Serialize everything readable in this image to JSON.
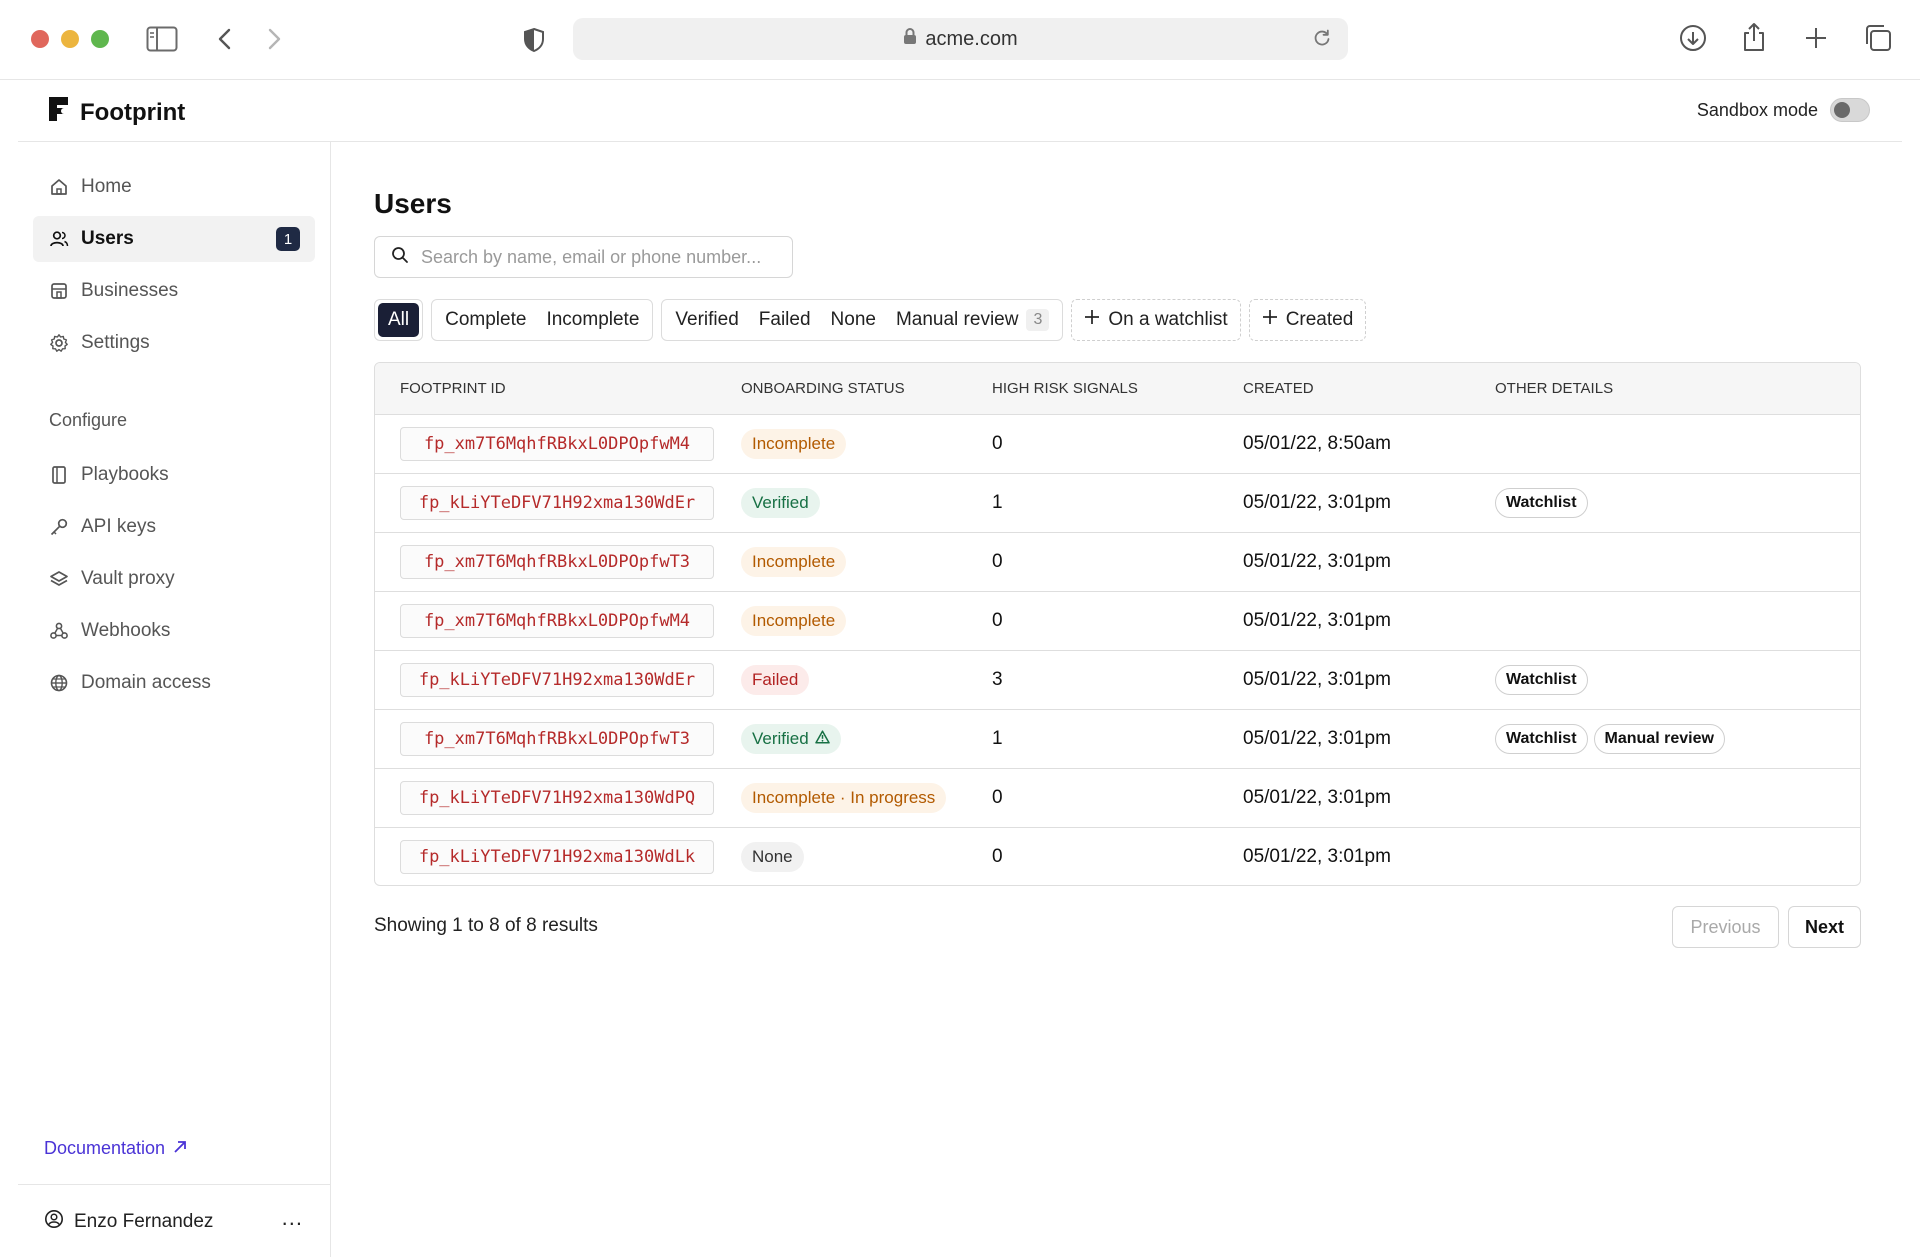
{
  "browser": {
    "url": "acme.com"
  },
  "app": {
    "brand": "Footprint",
    "sandbox_label": "Sandbox mode"
  },
  "sidebar": {
    "items": [
      {
        "label": "Home",
        "icon": "home-icon"
      },
      {
        "label": "Users",
        "icon": "users-icon",
        "badge": "1",
        "active": true
      },
      {
        "label": "Businesses",
        "icon": "store-icon"
      },
      {
        "label": "Settings",
        "icon": "gear-icon"
      }
    ],
    "configure_label": "Configure",
    "configure_items": [
      {
        "label": "Playbooks",
        "icon": "book-icon"
      },
      {
        "label": "API keys",
        "icon": "key-icon"
      },
      {
        "label": "Vault proxy",
        "icon": "layers-icon"
      },
      {
        "label": "Webhooks",
        "icon": "webhook-icon"
      },
      {
        "label": "Domain access",
        "icon": "globe-icon"
      }
    ],
    "documentation": "Documentation",
    "user_name": "Enzo Fernandez",
    "more": "..."
  },
  "main": {
    "title": "Users",
    "search_placeholder": "Search by name, email or phone number...",
    "filters": {
      "all": "All",
      "complete": "Complete",
      "incomplete": "Incomplete",
      "verified": "Verified",
      "failed": "Failed",
      "none": "None",
      "manual_review": "Manual review",
      "manual_review_count": "3",
      "watchlist": "On a watchlist",
      "created": "Created"
    },
    "columns": [
      "FOOTPRINT ID",
      "ONBOARDING STATUS",
      "HIGH RISK SIGNALS",
      "CREATED",
      "OTHER DETAILS"
    ],
    "rows": [
      {
        "id": "fp_xm7T6MqhfRBkxL0DPOpfwM4",
        "status": "Incomplete",
        "status_kind": "incomplete",
        "signals": "0",
        "created": "05/01/22, 8:50am",
        "tags": []
      },
      {
        "id": "fp_kLiYTeDFV71H92xma130WdEr",
        "status": "Verified",
        "status_kind": "verified",
        "signals": "1",
        "created": "05/01/22, 3:01pm",
        "tags": [
          "Watchlist"
        ]
      },
      {
        "id": "fp_xm7T6MqhfRBkxL0DPOpfwT3",
        "status": "Incomplete",
        "status_kind": "incomplete",
        "signals": "0",
        "created": "05/01/22, 3:01pm",
        "tags": []
      },
      {
        "id": "fp_xm7T6MqhfRBkxL0DPOpfwM4",
        "status": "Incomplete",
        "status_kind": "incomplete",
        "signals": "0",
        "created": "05/01/22, 3:01pm",
        "tags": []
      },
      {
        "id": "fp_kLiYTeDFV71H92xma130WdEr",
        "status": "Failed",
        "status_kind": "failed",
        "signals": "3",
        "created": "05/01/22, 3:01pm",
        "tags": [
          "Watchlist"
        ]
      },
      {
        "id": "fp_xm7T6MqhfRBkxL0DPOpfwT3",
        "status": "Verified",
        "status_kind": "verified",
        "warning": true,
        "signals": "1",
        "created": "05/01/22, 3:01pm",
        "tags": [
          "Watchlist",
          "Manual review"
        ]
      },
      {
        "id": "fp_kLiYTeDFV71H92xma130WdPQ",
        "status": "Incomplete · In progress",
        "status_kind": "incomplete",
        "signals": "0",
        "created": "05/01/22, 3:01pm",
        "tags": []
      },
      {
        "id": "fp_kLiYTeDFV71H92xma130WdLk",
        "status": "None",
        "status_kind": "none",
        "signals": "0",
        "created": "05/01/22, 3:01pm",
        "tags": []
      }
    ],
    "pagination": {
      "summary": "Showing 1 to 8 of 8 results",
      "previous": "Previous",
      "next": "Next"
    }
  }
}
